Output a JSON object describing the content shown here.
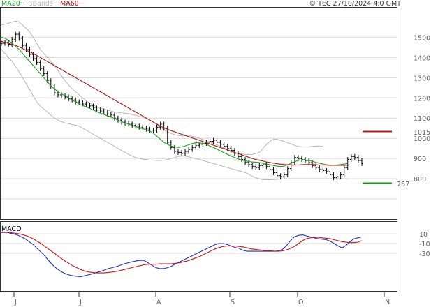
{
  "header": {
    "legend": [
      {
        "label": "MA20",
        "color": "#1aa31a"
      },
      {
        "label": "BBands",
        "color": "#b8b8b8"
      },
      {
        "label": "MA60",
        "color": "#b01010"
      }
    ],
    "copyright": "© TEC 27/10/2024 4:0 GMT"
  },
  "markers": {
    "resistance_value": "1015",
    "resistance_color": "#cc1111",
    "support_value": "767",
    "support_color": "#119911"
  },
  "macd_label": "MACD",
  "chart_data": [
    {
      "type": "line",
      "title": "",
      "x_labels": [
        "J",
        "J",
        "A",
        "S",
        "O",
        "N"
      ],
      "y_ticks": [
        "1500",
        "1400",
        "1300",
        "1200",
        "1100",
        "1000",
        "900",
        "800"
      ],
      "ylim": [
        600,
        1650
      ],
      "grid": true,
      "price_bars": [
        1470,
        1475,
        1465,
        1490,
        1515,
        1495,
        1460,
        1440,
        1415,
        1395,
        1375,
        1345,
        1320,
        1285,
        1255,
        1225,
        1215,
        1210,
        1205,
        1195,
        1190,
        1180,
        1175,
        1170,
        1165,
        1160,
        1150,
        1140,
        1135,
        1130,
        1120,
        1115,
        1100,
        1090,
        1080,
        1075,
        1070,
        1065,
        1060,
        1055,
        1050,
        1045,
        1040,
        1040,
        1055,
        1070,
        1050,
        980,
        955,
        935,
        930,
        925,
        935,
        945,
        955,
        965,
        970,
        975,
        980,
        985,
        990,
        980,
        970,
        960,
        950,
        940,
        925,
        910,
        895,
        880,
        870,
        860,
        855,
        865,
        870,
        860,
        845,
        830,
        815,
        810,
        820,
        850,
        880,
        905,
        900,
        895,
        890,
        880,
        865,
        855,
        845,
        840,
        835,
        820,
        805,
        810,
        820,
        855,
        895,
        910,
        905,
        890,
        875
      ],
      "series": [
        {
          "name": "MA20",
          "color": "#1aa31a",
          "values": [
            1500,
            1495,
            1485,
            1470,
            1455,
            1440,
            1420,
            1400,
            1380,
            1360,
            1340,
            1320,
            1300,
            1280,
            1260,
            1245,
            1230,
            1220,
            1210,
            1200,
            1190,
            1180,
            1170,
            1162,
            1155,
            1148,
            1140,
            1132,
            1125,
            1118,
            1112,
            1105,
            1098,
            1090,
            1083,
            1076,
            1070,
            1064,
            1058,
            1052,
            1047,
            1042,
            1035,
            1025,
            1010,
            995,
            980,
            970,
            962,
            958,
            955,
            957,
            962,
            968,
            974,
            978,
            978,
            975,
            970,
            962,
            955,
            946,
            937,
            928,
            920,
            912,
            905,
            898,
            892,
            888,
            885,
            883,
            882,
            880,
            877,
            873,
            869,
            865,
            862,
            860,
            862,
            868,
            876,
            884,
            890,
            893,
            893,
            890,
            886,
            881,
            877,
            873,
            869,
            867,
            866,
            868,
            870,
            872,
            875
          ]
        },
        {
          "name": "MA60",
          "color": "#b01010",
          "values": [
            1480,
            1475,
            1470,
            1465,
            1460,
            1452,
            1444,
            1436,
            1428,
            1420,
            1410,
            1400,
            1390,
            1380,
            1370,
            1360,
            1350,
            1340,
            1330,
            1320,
            1310,
            1300,
            1290,
            1280,
            1270,
            1260,
            1250,
            1240,
            1230,
            1220,
            1210,
            1200,
            1190,
            1180,
            1170,
            1160,
            1150,
            1140,
            1130,
            1120,
            1110,
            1100,
            1090,
            1080,
            1070,
            1060,
            1052,
            1045,
            1038,
            1032,
            1026,
            1020,
            1014,
            1008,
            1002,
            996,
            990,
            984,
            978,
            972,
            966,
            960,
            954,
            948,
            942,
            936,
            930,
            924,
            918,
            912,
            906,
            900,
            895,
            891,
            887,
            883,
            880,
            877,
            874,
            872,
            870,
            869,
            868,
            868,
            868,
            869,
            870,
            870,
            870,
            869,
            868,
            868,
            867,
            866,
            866,
            866,
            866,
            866,
            866
          ]
        },
        {
          "name": "BB Upper",
          "color": "#b8b8b8",
          "values": [
            1560,
            1565,
            1570,
            1575,
            1580,
            1575,
            1560,
            1545,
            1525,
            1500,
            1470,
            1440,
            1420,
            1400,
            1380,
            1360,
            1335,
            1310,
            1285,
            1265,
            1245,
            1230,
            1215,
            1200,
            1185,
            1175,
            1165,
            1155,
            1150,
            1145,
            1140,
            1135,
            1130,
            1128,
            1126,
            1124,
            1122,
            1118,
            1114,
            1110,
            1105,
            1098,
            1090,
            1080,
            1068,
            1055,
            1042,
            1032,
            1024,
            1018,
            1014,
            1012,
            1012,
            1012,
            1010,
            1006,
            1000,
            994,
            988,
            982,
            975,
            968,
            960,
            952,
            944,
            936,
            930,
            925,
            922,
            920,
            920,
            920,
            925,
            930,
            950,
            970,
            985,
            995,
            995,
            990,
            985,
            978,
            972,
            965,
            960,
            958,
            957,
            958,
            960,
            962,
            962,
            960
          ]
        },
        {
          "name": "BB Lower",
          "color": "#b8b8b8",
          "values": [
            1440,
            1420,
            1400,
            1380,
            1355,
            1330,
            1300,
            1270,
            1240,
            1210,
            1180,
            1160,
            1145,
            1130,
            1115,
            1100,
            1090,
            1082,
            1076,
            1072,
            1068,
            1065,
            1060,
            1050,
            1040,
            1030,
            1020,
            1010,
            1000,
            990,
            980,
            970,
            960,
            950,
            940,
            930,
            920,
            912,
            905,
            900,
            897,
            895,
            893,
            892,
            890,
            890,
            892,
            895,
            900,
            905,
            910,
            912,
            912,
            908,
            904,
            900,
            895,
            890,
            885,
            880,
            875,
            870,
            865,
            860,
            855,
            850,
            845,
            840,
            835,
            830,
            822,
            812,
            805,
            800,
            795,
            795,
            795,
            796,
            797,
            798,
            799,
            800,
            800,
            800,
            800,
            800,
            800,
            800,
            800,
            800,
            800,
            800,
            800,
            800,
            800,
            800,
            800,
            800,
            800
          ]
        }
      ],
      "xlabel": "",
      "ylabel": ""
    },
    {
      "type": "line",
      "title": "MACD",
      "y_ticks": [
        "10",
        "-10",
        "-30"
      ],
      "ylim": [
        -110,
        35
      ],
      "grid": true,
      "series": [
        {
          "name": "MACD",
          "color": "#1d2ec9",
          "values": [
            14,
            14,
            12,
            10,
            8,
            4,
            0,
            -6,
            -12,
            -20,
            -28,
            -36,
            -46,
            -55,
            -62,
            -68,
            -72,
            -75,
            -77,
            -78,
            -79,
            -77,
            -75,
            -73,
            -70,
            -68,
            -65,
            -62,
            -60,
            -58,
            -55,
            -52,
            -50,
            -48,
            -46,
            -45,
            -45,
            -50,
            -55,
            -60,
            -62,
            -62,
            -60,
            -57,
            -52,
            -48,
            -44,
            -40,
            -36,
            -32,
            -28,
            -24,
            -20,
            -16,
            -12,
            -10,
            -10,
            -12,
            -15,
            -18,
            -20,
            -24,
            -26,
            -26,
            -26,
            -26,
            -26,
            -26,
            -26,
            -26,
            -25,
            -22,
            -14,
            -4,
            4,
            7,
            8,
            6,
            4,
            2,
            0,
            -1,
            -2,
            -5,
            -10,
            -15,
            -19,
            -14,
            -6,
            0,
            2,
            4
          ]
        },
        {
          "name": "Signal",
          "color": "#d01010",
          "values": [
            13,
            13,
            13,
            12,
            11,
            9,
            7,
            4,
            0,
            -5,
            -10,
            -16,
            -22,
            -28,
            -34,
            -40,
            -46,
            -51,
            -56,
            -60,
            -64,
            -67,
            -69,
            -70,
            -71,
            -71,
            -71,
            -70,
            -69,
            -68,
            -66,
            -64,
            -62,
            -60,
            -58,
            -56,
            -54,
            -53,
            -53,
            -53,
            -52,
            -52,
            -52,
            -52,
            -51,
            -50,
            -48,
            -46,
            -43,
            -40,
            -37,
            -33,
            -29,
            -25,
            -21,
            -18,
            -16,
            -15,
            -15,
            -15,
            -16,
            -17,
            -19,
            -21,
            -22,
            -23,
            -24,
            -25,
            -25,
            -26,
            -26,
            -25,
            -23,
            -20,
            -16,
            -10,
            -4,
            0,
            2,
            3,
            3,
            2,
            1,
            0,
            -2,
            -4,
            -6,
            -7,
            -8,
            -8,
            -7,
            -4
          ]
        }
      ]
    }
  ]
}
